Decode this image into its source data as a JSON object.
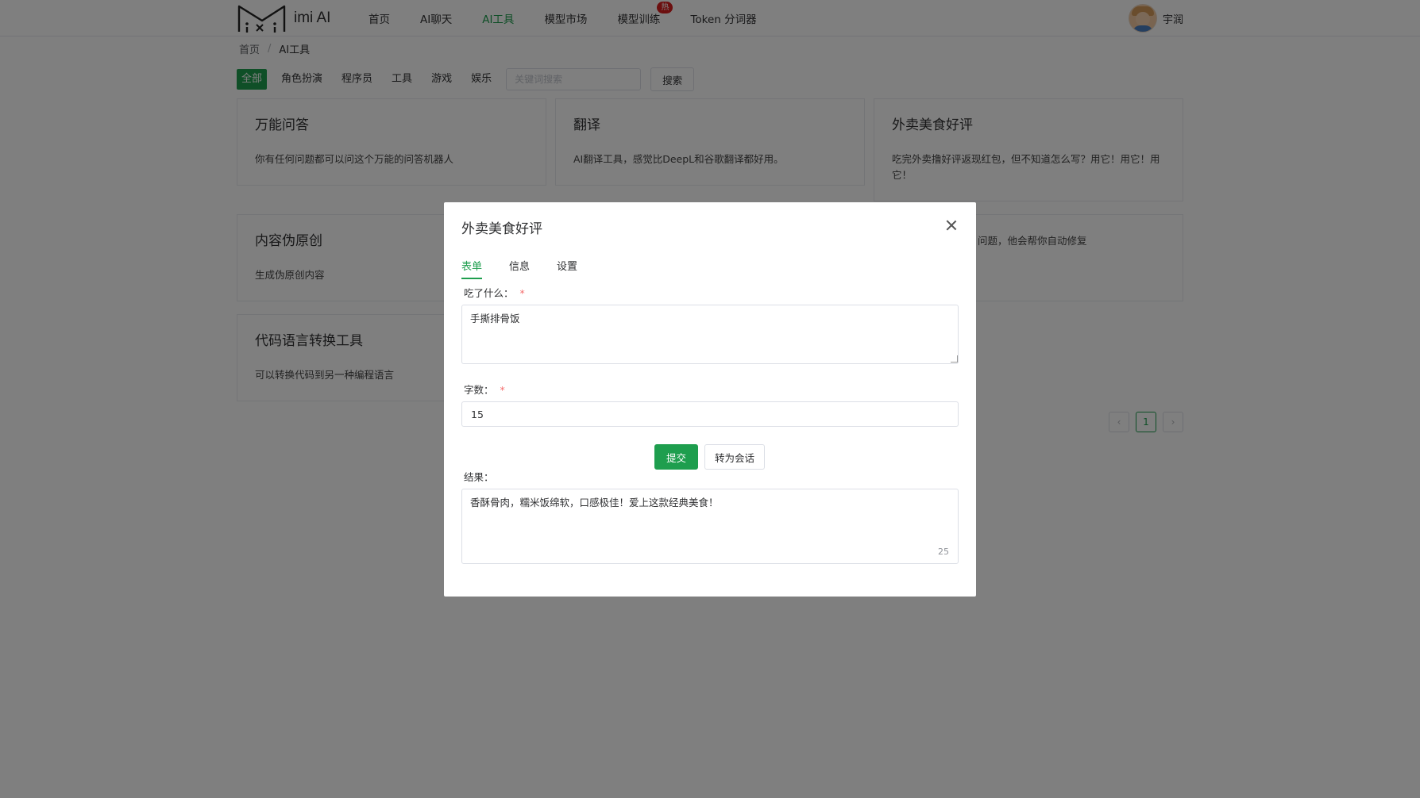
{
  "header": {
    "logo_text": "imi AI",
    "nav": [
      {
        "label": "首页"
      },
      {
        "label": "AI聊天"
      },
      {
        "label": "AI工具"
      },
      {
        "label": "模型市场"
      },
      {
        "label": "模型训练",
        "badge": "热"
      },
      {
        "label": "Token 分词器"
      }
    ],
    "active_nav": "AI工具",
    "user_name": "宇润"
  },
  "breadcrumb": {
    "home": "首页",
    "separator": "/",
    "current": "AI工具"
  },
  "categories": {
    "items": [
      "全部",
      "角色扮演",
      "程序员",
      "工具",
      "游戏",
      "娱乐"
    ],
    "active": "全部",
    "search_placeholder": "关键词搜索",
    "search_label": "搜索"
  },
  "cards": [
    {
      "title": "万能问答",
      "desc": "你有任何问题都可以问这个万能的问答机器人"
    },
    {
      "title": "翻译",
      "desc": "AI翻译工具，感觉比DeepL和谷歌翻译都好用。"
    },
    {
      "title": "外卖美食好评",
      "desc": "吃完外卖撸好评返现红包，但不知道怎么写？用它！用它！用它！"
    },
    {
      "title": "内容伪原创",
      "desc": "生成伪原创内容"
    },
    {
      "title": "",
      "desc": "问题，他会帮你自动修复"
    },
    {
      "title": "代码语言转换工具",
      "desc": "可以转换代码到另一种编程语言"
    }
  ],
  "pagination": {
    "prev": "‹",
    "current": "1",
    "next": "›"
  },
  "modal": {
    "title": "外卖美食好评",
    "tabs": [
      "表单",
      "信息",
      "设置"
    ],
    "active_tab": "表单",
    "field1_label": "吃了什么：",
    "field1_value": "手撕排骨饭",
    "field2_label": "字数：",
    "field2_value": "15",
    "required_mark": "*",
    "submit_label": "提交",
    "convert_label": "转为会话",
    "result_label": "结果：",
    "result_value": "香酥骨肉，糯米饭绵软，口感极佳！爱上这款经典美食！",
    "result_count": "25"
  },
  "colors": {
    "accent": "#1e9e4e",
    "badge": "#d81e1e",
    "required": "#f56c6c"
  }
}
